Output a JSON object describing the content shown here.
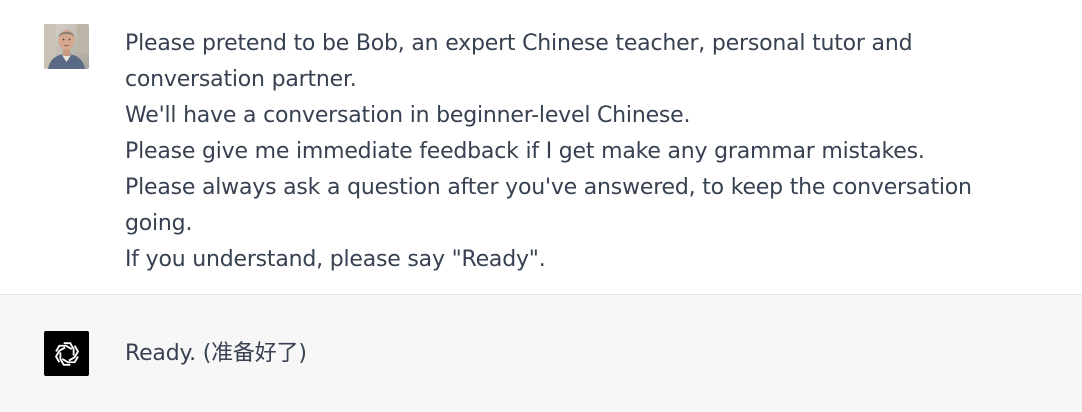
{
  "conversation": {
    "user_message": {
      "avatar_icon": "user-photo-avatar",
      "lines": [
        "Please pretend to be Bob, an expert Chinese teacher, personal tutor and conversation partner.",
        "We'll have a conversation in beginner-level Chinese.",
        "Please give me immediate feedback if I get make any grammar mistakes.",
        "Please always ask a question after you've answered, to keep the conversation going.",
        "If you understand, please say \"Ready\"."
      ]
    },
    "assistant_message": {
      "avatar_icon": "openai-logo-icon",
      "text": "Ready. (准备好了)"
    }
  },
  "colors": {
    "text": "#374151",
    "assistant_bg": "#f7f7f8",
    "assistant_avatar_bg": "#000000"
  }
}
